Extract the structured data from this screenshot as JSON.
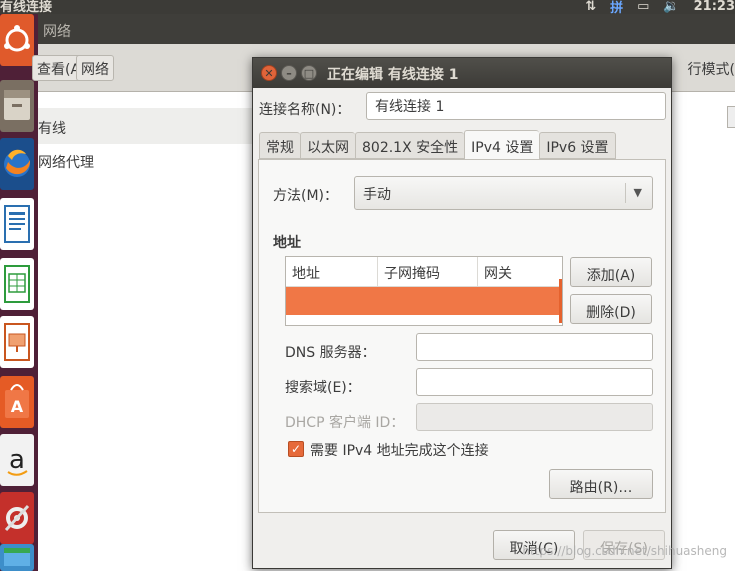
{
  "top_panel": {
    "window_title": "有线连接",
    "ime_indicator": "拼",
    "clock": "21:23"
  },
  "launcher": {
    "items": [
      "ubuntu-dash-icon",
      "files-icon",
      "firefox-icon",
      "writer-icon",
      "calc-icon",
      "impress-icon",
      "software-center-icon",
      "amazon-icon",
      "settings-icon",
      "installer-icon"
    ]
  },
  "bg_window": {
    "title": "网络",
    "toolbar": {
      "edit_btn": "查看(A)",
      "network_btn": "网络",
      "right_label": "行模式("
    },
    "list": {
      "selected": "有线",
      "proxy": "网络代理"
    }
  },
  "dialog": {
    "title": "正在编辑 有线连接 1",
    "conn_name_label": "连接名称(N)：",
    "conn_name_value": "有线连接 1",
    "tabs": [
      "常规",
      "以太网",
      "802.1X 安全性",
      "IPv4 设置",
      "IPv6 设置"
    ],
    "active_tab": 3,
    "method_label": "方法(M)：",
    "method_value": "手动",
    "address_section": "地址",
    "columns": [
      "地址",
      "子网掩码",
      "网关"
    ],
    "add_btn": "添加(A)",
    "delete_btn": "删除(D)",
    "dns_label": "DNS 服务器：",
    "search_label": "搜索域(E)：",
    "dhcp_label": "DHCP 客户端 ID：",
    "require_ipv4_label": "需要 IPv4 地址完成这个连接",
    "require_ipv4_checked": true,
    "routes_btn": "路由(R)…",
    "cancel_btn": "取消(C)",
    "save_btn": "保存(S)"
  },
  "watermark": "https://blog.csdn.net/shihuasheng",
  "colors": {
    "accent": "#f07746",
    "launcher": "#4f2037",
    "panel": "#3c3b37"
  }
}
